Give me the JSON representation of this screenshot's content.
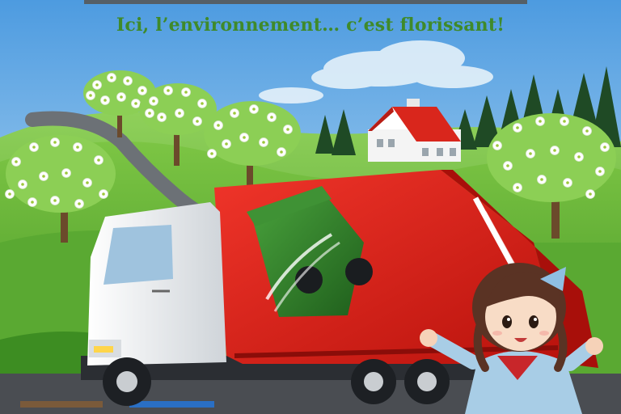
{
  "headline": "Ici, l’environnement… c’est florissant!",
  "colors": {
    "sky_top": "#4d9be0",
    "sky_bottom": "#cfe8f7",
    "hill_green": "#5fae34",
    "grass_dark": "#3b8a22",
    "truck_red": "#e01b12",
    "bin_green": "#2f7d2a",
    "cab_white": "#f2f4f6",
    "road": "#4a4d52",
    "roof_red": "#d9261c",
    "headline_green": "#3f8a2a"
  },
  "icons": [
    "flowering-tree-icon",
    "pine-tree-icon",
    "farmhouse-icon",
    "garbage-truck-icon",
    "green-bin-icon",
    "girl-character-icon",
    "cloud-icon"
  ]
}
